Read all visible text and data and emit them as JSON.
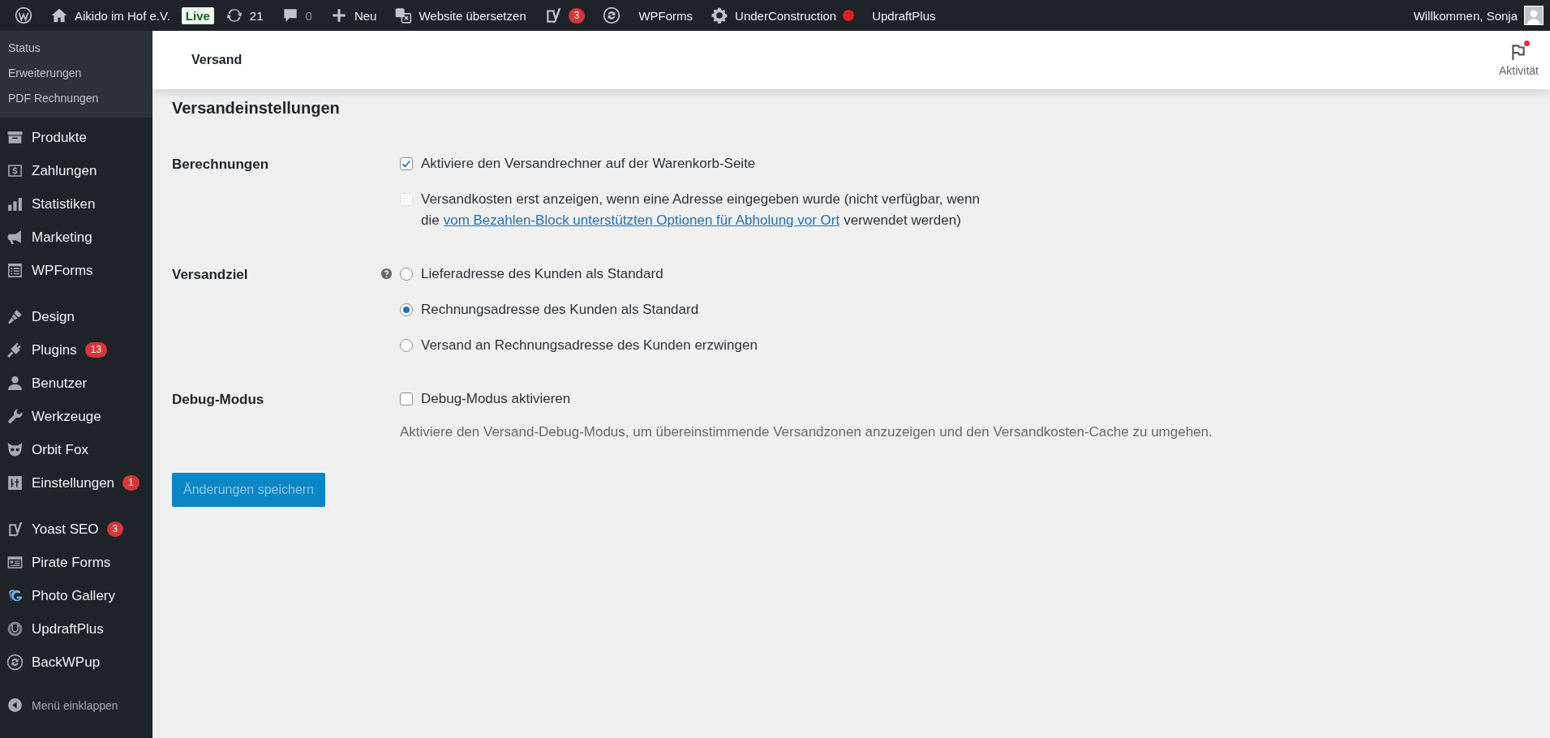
{
  "admin_bar": {
    "items": [
      {
        "kind": "icon"
      },
      {
        "kind": "link",
        "label": "Aikido im Hof e.V."
      },
      {
        "kind": "tag",
        "tag": "Live"
      },
      {
        "kind": "link",
        "label": "21"
      },
      {
        "kind": "link",
        "label": "0",
        "muted": true
      },
      {
        "kind": "link",
        "label": "Neu"
      },
      {
        "kind": "link",
        "label": "Website übersetzen"
      },
      {
        "kind": "icon",
        "badge": "3"
      },
      {
        "kind": "icon"
      },
      {
        "kind": "link",
        "label": "WPForms"
      },
      {
        "kind": "link",
        "label": "UnderConstruction",
        "alert": true
      },
      {
        "kind": "link",
        "label": "UpdraftPlus"
      }
    ],
    "account": "Willkommen, Sonja"
  },
  "sidebar": {
    "submenu": [
      "Status",
      "Erweiterungen",
      "PDF Rechnungen"
    ],
    "groups": [
      [
        {
          "label": "Produkte"
        },
        {
          "label": "Zahlungen"
        },
        {
          "label": "Statistiken"
        },
        {
          "label": "Marketing"
        },
        {
          "label": "WPForms"
        }
      ],
      [
        {
          "label": "Design"
        },
        {
          "label": "Plugins",
          "badge": "13"
        },
        {
          "label": "Benutzer"
        },
        {
          "label": "Werkzeuge"
        },
        {
          "label": "Orbit Fox"
        },
        {
          "label": "Einstellungen",
          "badge": "1"
        }
      ],
      [
        {
          "label": "Yoast SEO",
          "badge": "3"
        },
        {
          "label": "Pirate Forms"
        },
        {
          "label": "Photo Gallery"
        },
        {
          "label": "UpdraftPlus"
        },
        {
          "label": "BackWPup"
        }
      ]
    ],
    "collapse": "Menü einklappen"
  },
  "header": {
    "title": "Versand",
    "activity": "Aktivität",
    "has_notification": true
  },
  "settings": {
    "heading": "Versandeinstellungen",
    "rows": [
      {
        "label": "Berechnungen",
        "help": false,
        "options": [
          {
            "kind": "checkbox",
            "text": "Aktiviere den Versandrechner auf der Warenkorb-Seite",
            "checked": true,
            "disabled": false
          },
          {
            "kind": "checkbox",
            "text": "Versandkosten erst anzeigen, wenn eine Adresse eingegeben wurde (nicht verfügbar, wenn die",
            "link": "vom Bezahlen-Block unterstützten Optionen für Abholung vor Ort",
            "text_after": "verwendet werden)",
            "checked": false,
            "disabled": true
          }
        ]
      },
      {
        "label": "Versandziel",
        "help": true,
        "options": [
          {
            "kind": "radio",
            "text": "Lieferadresse des Kunden als Standard",
            "selected": false
          },
          {
            "kind": "radio",
            "text": "Rechnungsadresse des Kunden als Standard",
            "selected": true
          },
          {
            "kind": "radio",
            "text": "Versand an Rechnungsadresse des Kunden erzwingen",
            "selected": false
          }
        ]
      },
      {
        "label": "Debug-Modus",
        "help": false,
        "options": [
          {
            "kind": "checkbox",
            "text": "Debug-Modus aktivieren",
            "checked": false,
            "disabled": false
          }
        ],
        "description": "Aktiviere den Versand-Debug-Modus, um übereinstimmende Versandzonen anzuzeigen und den Versandkosten-Cache zu umgehen."
      }
    ]
  },
  "save_button": {
    "label": "Änderungen speichern",
    "disabled": true
  }
}
